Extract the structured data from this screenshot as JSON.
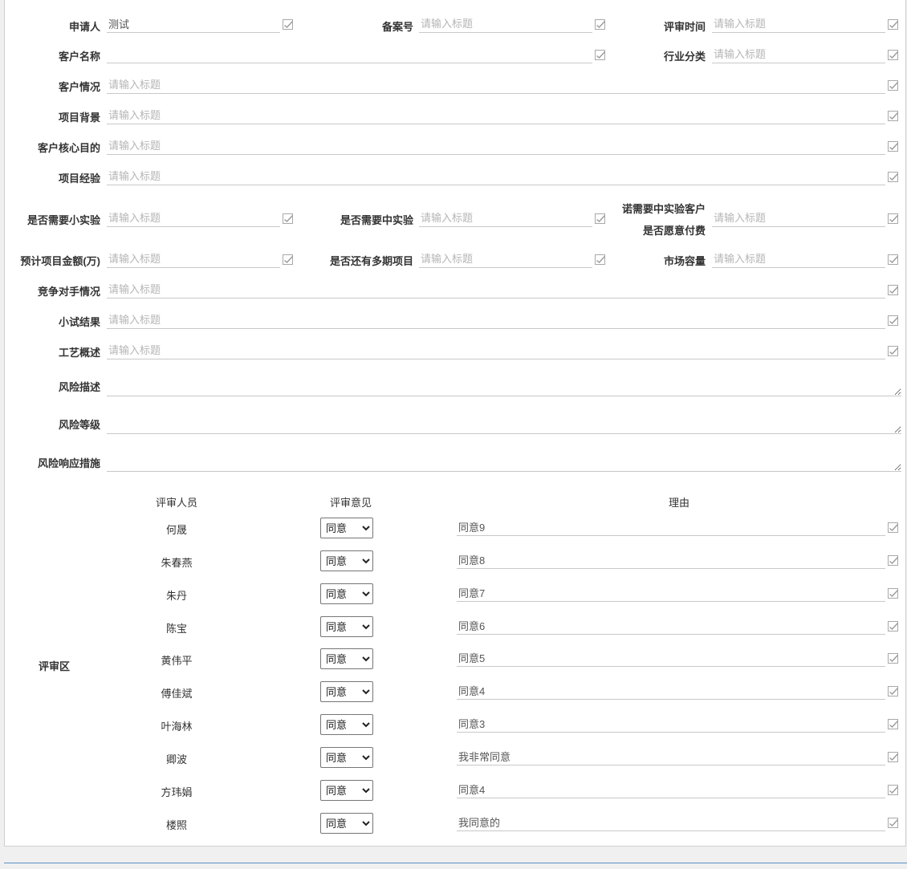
{
  "fields": {
    "applicant": {
      "label": "申请人",
      "value": "测试"
    },
    "record_no": {
      "label": "备案号",
      "placeholder": "请输入标题"
    },
    "review_time": {
      "label": "评审时间",
      "placeholder": "请输入标题"
    },
    "customer_name": {
      "label": "客户名称",
      "value": ""
    },
    "industry": {
      "label": "行业分类",
      "placeholder": "请输入标题"
    },
    "customer_situation": {
      "label": "客户情况",
      "placeholder": "请输入标题"
    },
    "project_background": {
      "label": "项目背景",
      "placeholder": "请输入标题"
    },
    "customer_goal": {
      "label": "客户核心目的",
      "placeholder": "请输入标题"
    },
    "project_experience": {
      "label": "项目经验",
      "placeholder": "请输入标题"
    },
    "small_test": {
      "label": "是否需要小实验",
      "placeholder": "请输入标题"
    },
    "mid_test": {
      "label": "是否需要中实验",
      "placeholder": "请输入标题"
    },
    "mid_test_pay": {
      "label_line1": "诺需要中实验客户",
      "label_line2": "是否愿意付费",
      "placeholder": "请输入标题"
    },
    "amount": {
      "label": "预计项目金额(万)",
      "placeholder": "请输入标题"
    },
    "multi_phase": {
      "label": "是否还有多期项目",
      "placeholder": "请输入标题"
    },
    "market": {
      "label": "市场容量",
      "placeholder": "请输入标题"
    },
    "competitor": {
      "label": "竞争对手情况",
      "placeholder": "请输入标题"
    },
    "small_result": {
      "label": "小试结果",
      "placeholder": "请输入标题"
    },
    "process": {
      "label": "工艺概述",
      "placeholder": "请输入标题"
    },
    "risk_desc": {
      "label": "风险描述"
    },
    "risk_level": {
      "label": "风险等级"
    },
    "risk_response": {
      "label": "风险响应措施"
    }
  },
  "review": {
    "section_label": "评审区",
    "headers": {
      "reviewer": "评审人员",
      "opinion": "评审意见",
      "reason": "理由"
    },
    "options": [
      "同意"
    ],
    "rows": [
      {
        "name": "何晟",
        "opinion": "同意",
        "reason": "同意9"
      },
      {
        "name": "朱春燕",
        "opinion": "同意",
        "reason": "同意8"
      },
      {
        "name": "朱丹",
        "opinion": "同意",
        "reason": "同意7"
      },
      {
        "name": "陈宝",
        "opinion": "同意",
        "reason": "同意6"
      },
      {
        "name": "黄伟平",
        "opinion": "同意",
        "reason": "同意5"
      },
      {
        "name": "傅佳斌",
        "opinion": "同意",
        "reason": "同意4"
      },
      {
        "name": "叶海林",
        "opinion": "同意",
        "reason": "同意3"
      },
      {
        "name": "卿波",
        "opinion": "同意",
        "reason": "我非常同意"
      },
      {
        "name": "方玮娟",
        "opinion": "同意",
        "reason": "同意4"
      },
      {
        "name": "楼照",
        "opinion": "同意",
        "reason": "我同意的"
      }
    ]
  },
  "colors": {
    "accent_line": "#5b8fc9",
    "placeholder": "#b5b5b5",
    "border": "#c8c8c8"
  }
}
